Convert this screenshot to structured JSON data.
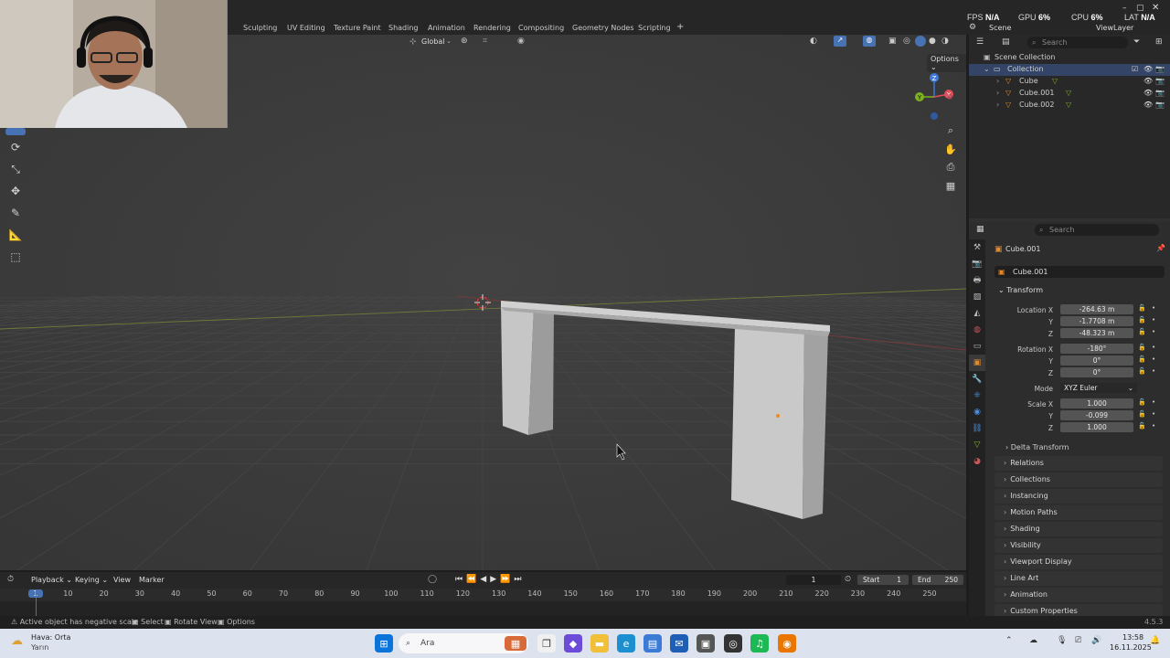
{
  "workspace_tabs": [
    "Sculpting",
    "UV Editing",
    "Texture Paint",
    "Shading",
    "Animation",
    "Rendering",
    "Compositing",
    "Geometry Nodes",
    "Scripting"
  ],
  "add_tab": "+",
  "stats": {
    "fps_label": "FPS",
    "fps_value": "N/A",
    "gpu_label": "GPU",
    "gpu_value": "6%",
    "cpu_label": "CPU",
    "cpu_value": "6%",
    "lat_label": "LAT",
    "lat_value": "N/A"
  },
  "scene_name": "Scene",
  "view_layer": "ViewLayer",
  "viewport": {
    "transform_orientation": "Global",
    "options_label": "Options",
    "gizmo_axes": [
      "Z",
      "Y",
      "X"
    ]
  },
  "outliner": {
    "search_placeholder": "Search",
    "scene_collection": "Scene Collection",
    "collection": "Collection",
    "objects": [
      "Cube",
      "Cube.001",
      "Cube.002"
    ]
  },
  "properties": {
    "search_placeholder": "Search",
    "object_name": "Cube.001",
    "object_datablock": "Cube.001",
    "transform_header": "Transform",
    "location_label": "Location X",
    "location": [
      "-264.63 m",
      "-1.7708 m",
      "-48.323 m"
    ],
    "rotation_label": "Rotation X",
    "rotation": [
      "-180°",
      "0°",
      "0°"
    ],
    "axis_y": "Y",
    "axis_z": "Z",
    "mode_label": "Mode",
    "mode_value": "XYZ Euler",
    "scale_label": "Scale X",
    "scale": [
      "1.000",
      "-0.099",
      "1.000"
    ],
    "delta_transform": "Delta Transform",
    "panels": [
      "Relations",
      "Collections",
      "Instancing",
      "Motion Paths",
      "Shading",
      "Visibility",
      "Viewport Display",
      "Line Art",
      "Animation",
      "Custom Properties"
    ]
  },
  "timeline": {
    "menus": [
      "Playback",
      "Keying",
      "View",
      "Marker"
    ],
    "current_frame": "1",
    "start_label": "Start",
    "start_value": "1",
    "end_label": "End",
    "end_value": "250",
    "ruler_ticks": [
      "1",
      "10",
      "20",
      "30",
      "40",
      "50",
      "60",
      "70",
      "80",
      "90",
      "100",
      "110",
      "120",
      "130",
      "140",
      "150",
      "160",
      "170",
      "180",
      "190",
      "200",
      "210",
      "220",
      "230",
      "240",
      "250"
    ]
  },
  "status_bar": {
    "warning": "Active object has negative scale",
    "select": "Select",
    "rotate_view": "Rotate View",
    "options": "Options",
    "version": "4.5.3"
  },
  "taskbar": {
    "weather_line1": "Hava: Orta",
    "weather_line2": "Yarın",
    "search_placeholder": "Ara",
    "time": "13:58",
    "date": "16.11.2025"
  },
  "colors": {
    "accent_blue": "#4772b3",
    "axis_x": "#e04e5a",
    "axis_y": "#7fb01f",
    "axis_z": "#3f79d8",
    "origin": "#f08a1f"
  }
}
